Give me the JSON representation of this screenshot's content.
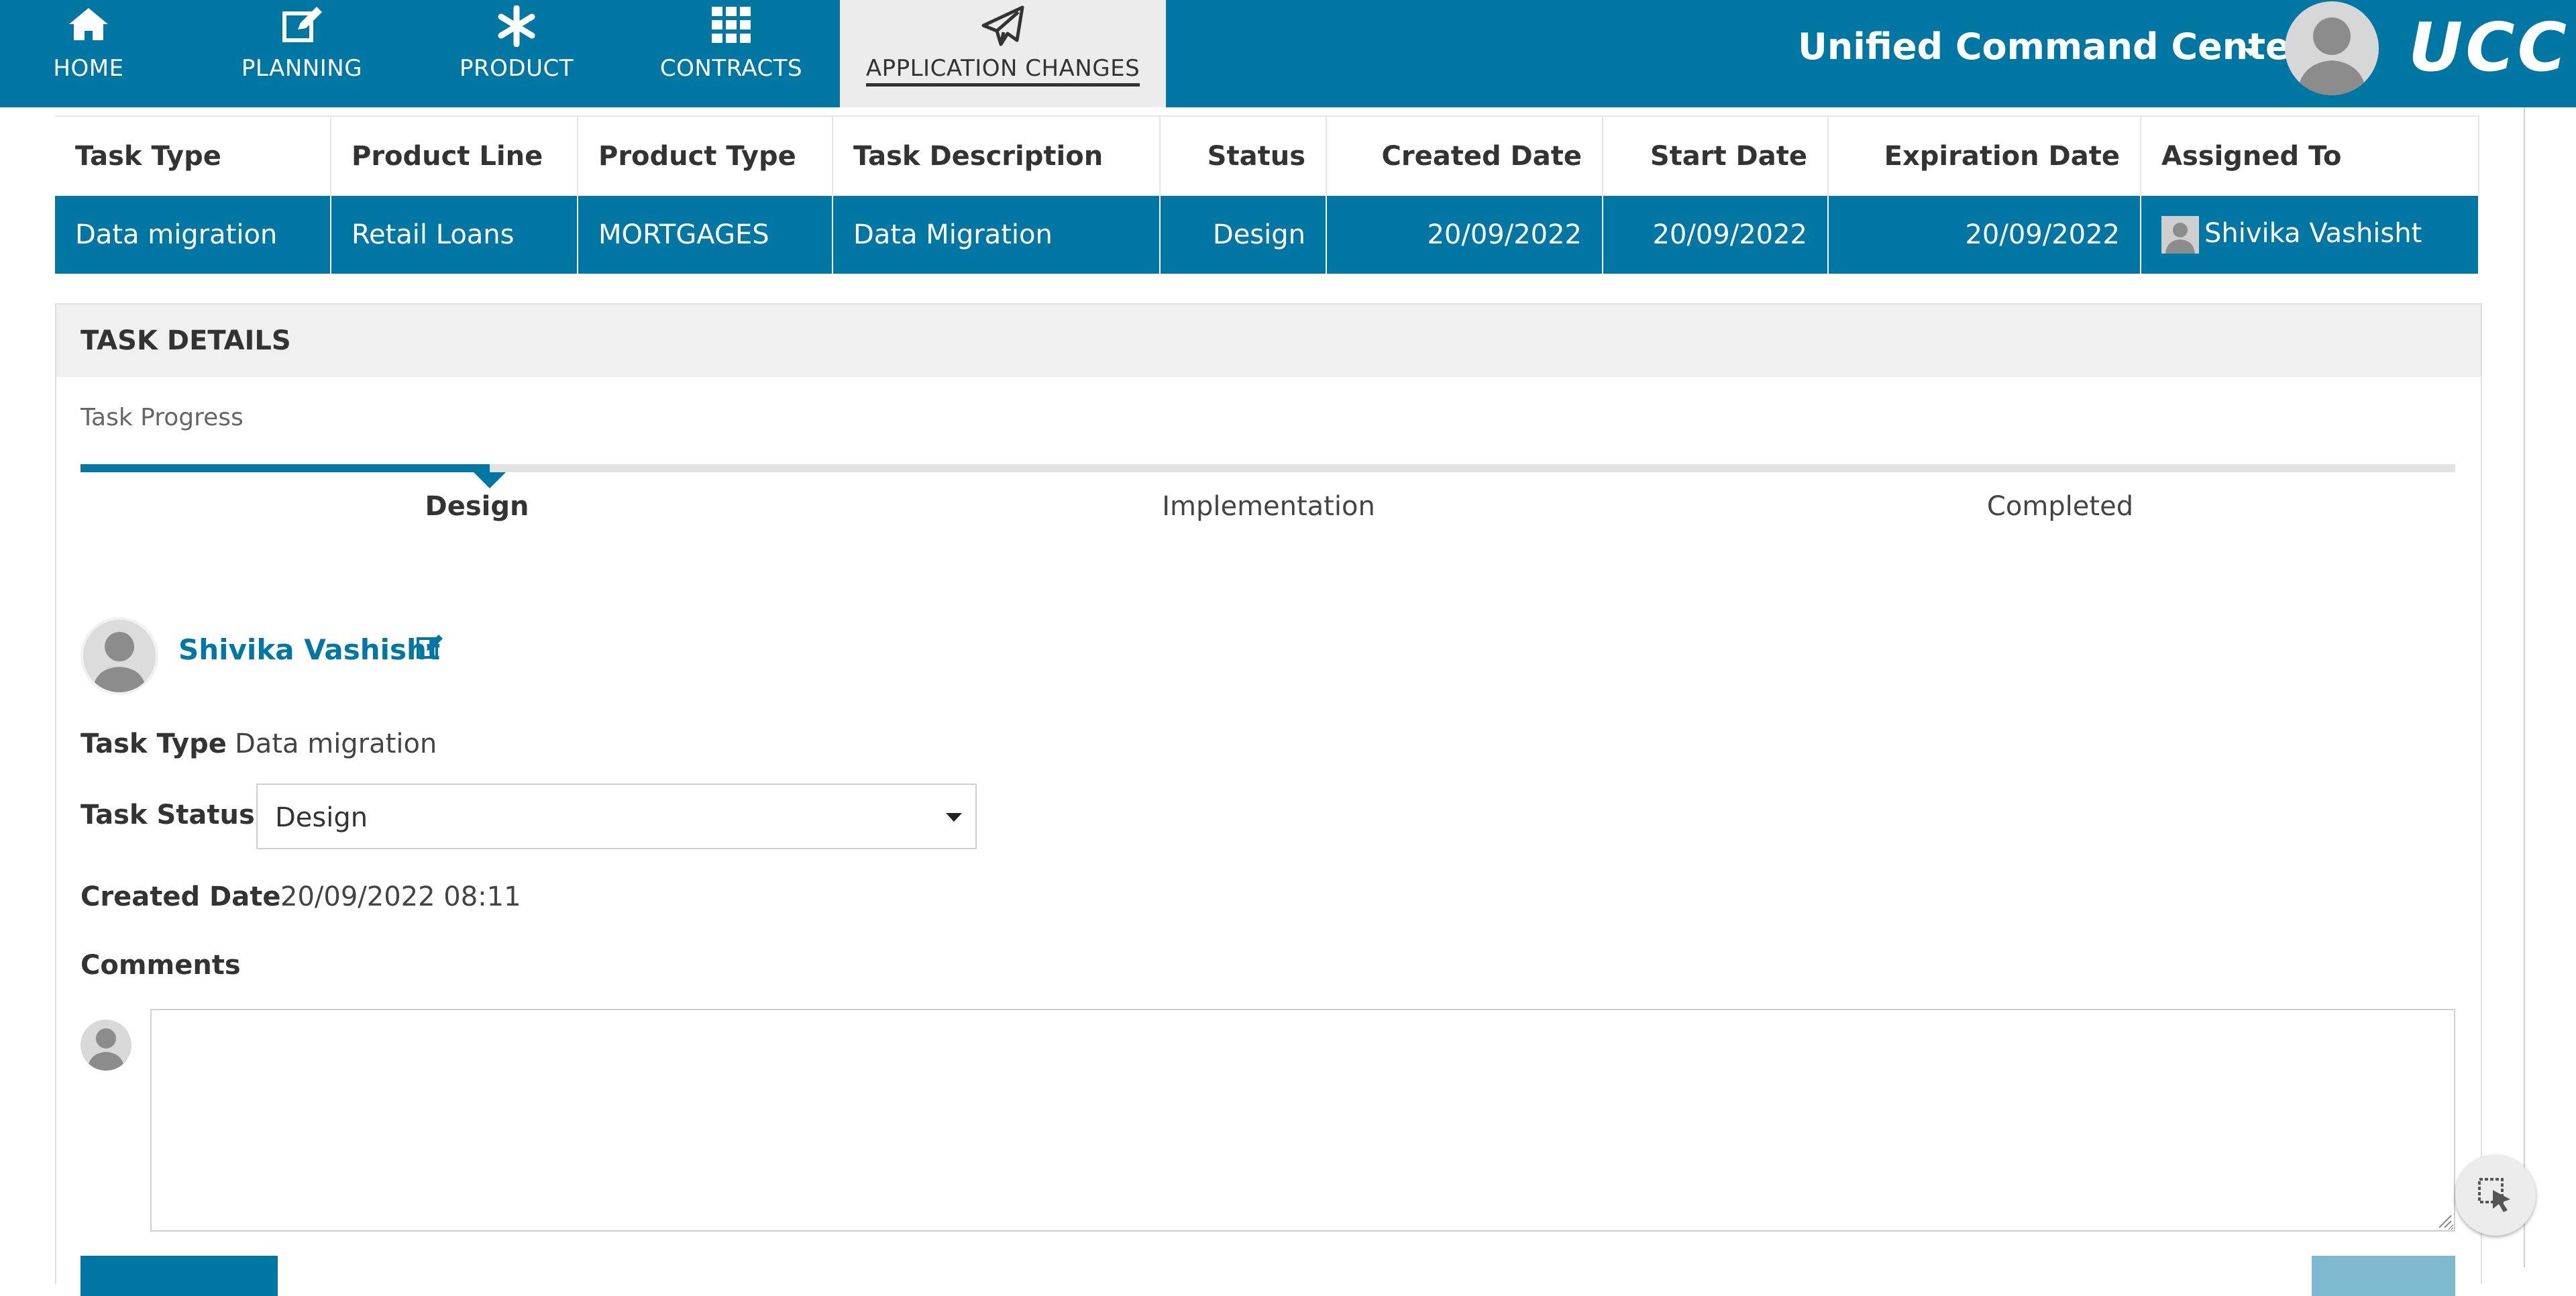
{
  "nav": {
    "items": [
      {
        "label": "HOME",
        "icon": "home-icon"
      },
      {
        "label": "PLANNING",
        "icon": "edit-icon"
      },
      {
        "label": "PRODUCT",
        "icon": "asterisk-icon"
      },
      {
        "label": "CONTRACTS",
        "icon": "grid-icon"
      },
      {
        "label": "APPLICATION CHANGES",
        "icon": "paper-plane-icon",
        "active": true
      }
    ],
    "workspace": "Unified Command Center",
    "logo": "UCC"
  },
  "table": {
    "headers": [
      "Task Type",
      "Product Line",
      "Product Type",
      "Task Description",
      "Status",
      "Created Date",
      "Start Date",
      "Expiration Date",
      "Assigned To"
    ],
    "rows": [
      [
        "Data migration",
        "Retail Loans",
        "MORTGAGES",
        "Data Migration",
        "Design",
        "20/09/2022",
        "20/09/2022",
        "20/09/2022",
        "Shivika Vashisht"
      ]
    ]
  },
  "details": {
    "title": "TASK DETAILS",
    "progress_label": "Task Progress",
    "stages": [
      "Design",
      "Implementation",
      "Completed"
    ],
    "current_stage": "Design",
    "user_name": "Shivika Vashisht",
    "task_type_label": "Task Type",
    "task_type_value": "Data migration",
    "task_status_label": "Task Status",
    "task_status_value": "Design",
    "created_date_label": "Created Date",
    "created_date_value": "20/09/2022 08:11",
    "comments_label": "Comments",
    "comment_value": ""
  },
  "colors": {
    "brand": "#0077a3",
    "active_tab_bg": "#ececec",
    "panel_header_bg": "#f0f0f0"
  }
}
